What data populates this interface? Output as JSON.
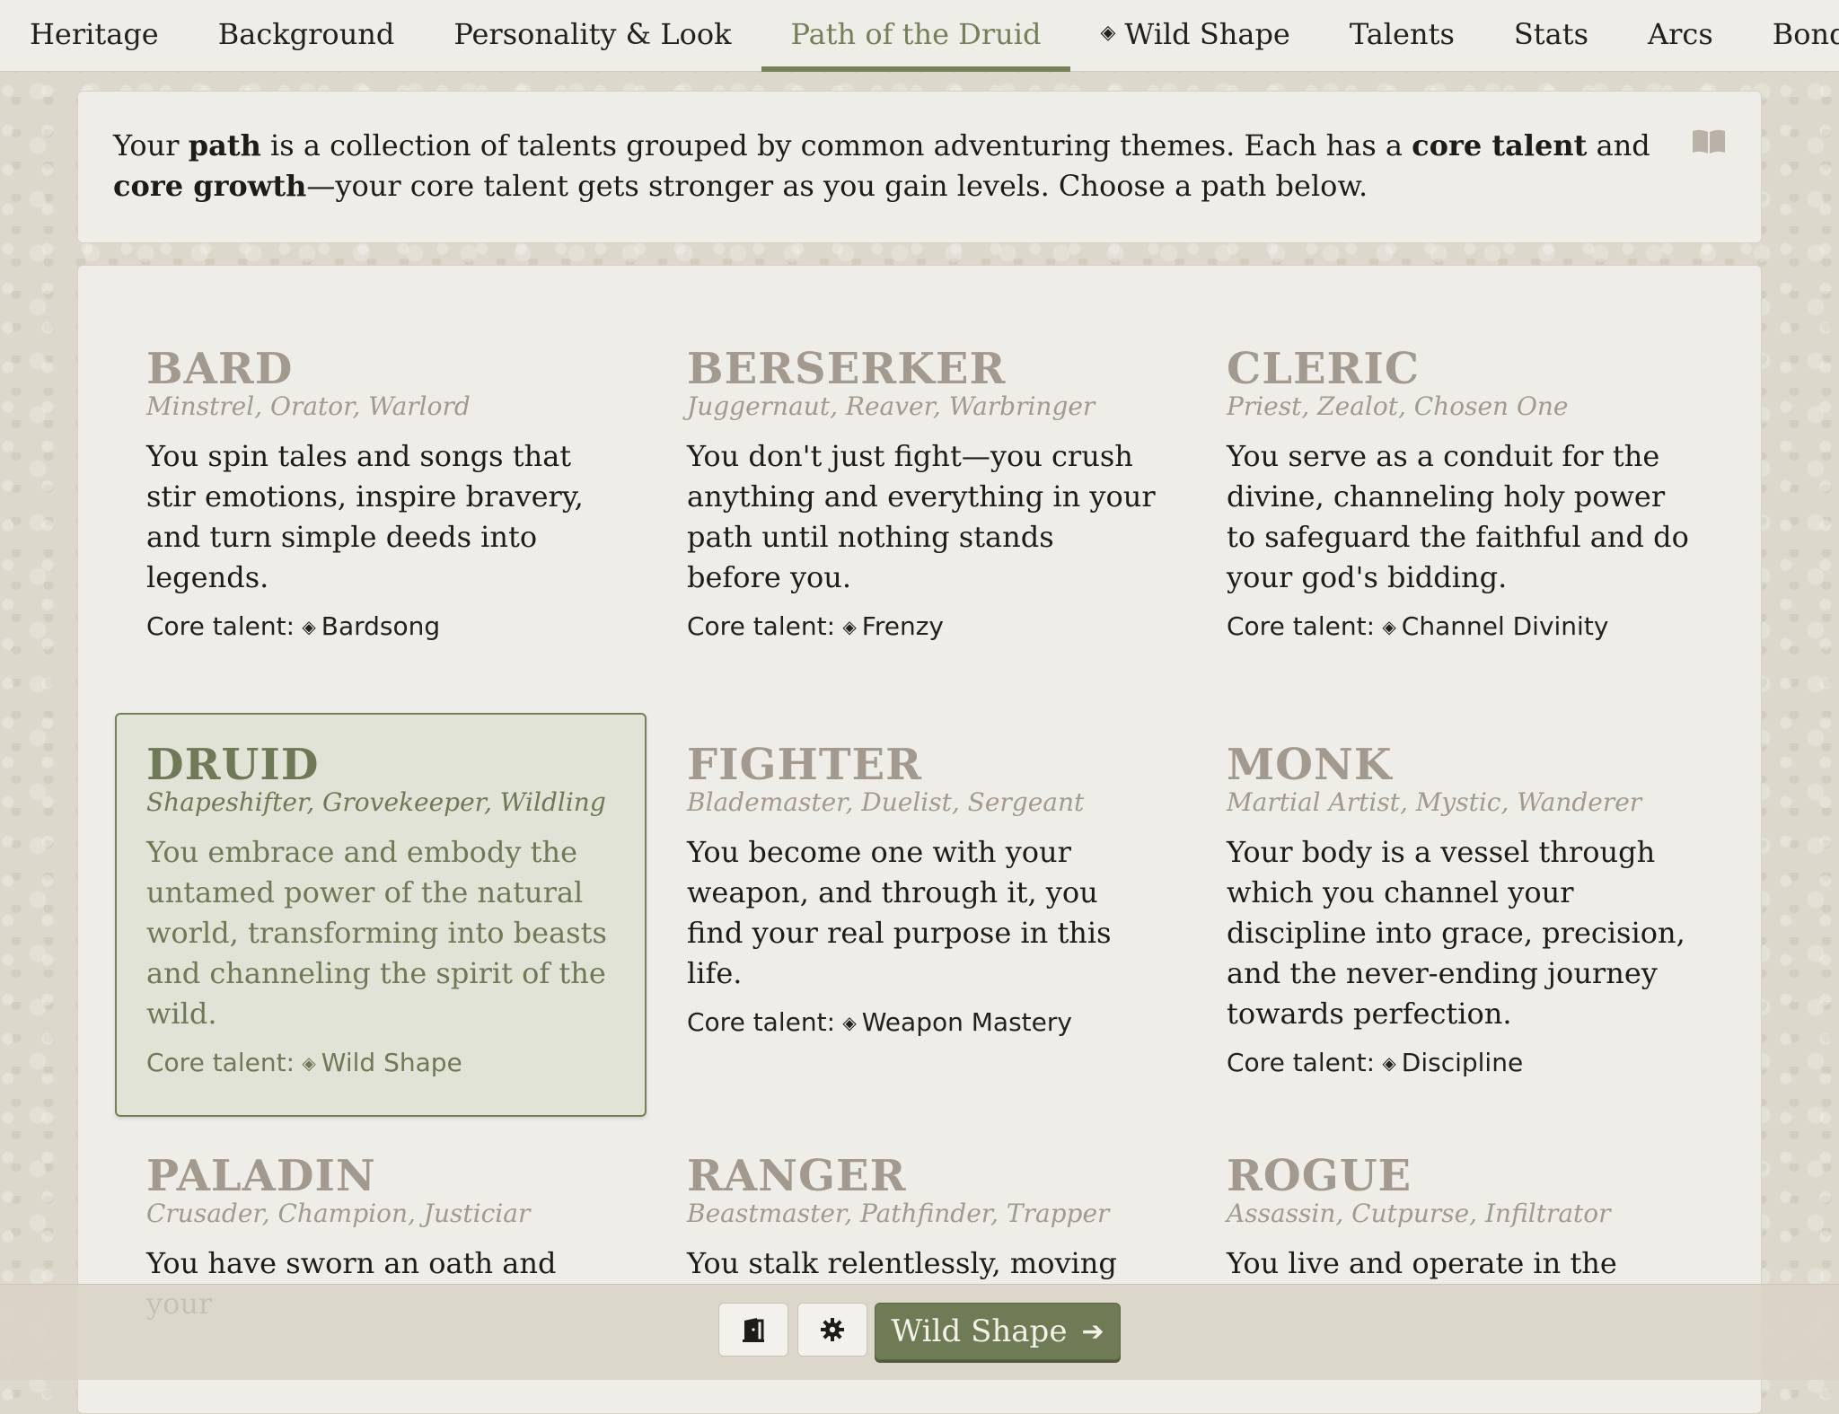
{
  "tabs": [
    {
      "label": "Heritage",
      "diamond": false
    },
    {
      "label": "Background",
      "diamond": false
    },
    {
      "label": "Personality & Look",
      "diamond": false
    },
    {
      "label": "Path of the Druid",
      "diamond": false,
      "active": true
    },
    {
      "label": "Wild Shape",
      "diamond": true
    },
    {
      "label": "Talents",
      "diamond": false
    },
    {
      "label": "Stats",
      "diamond": false
    },
    {
      "label": "Arcs",
      "diamond": false
    },
    {
      "label": "Bonds",
      "diamond": false
    }
  ],
  "intro": {
    "t1": "Your ",
    "b1": "path",
    "t2": " is a collection of talents grouped by common adventuring themes. Each has a ",
    "b2": "core talent",
    "t3": " and ",
    "b3": "core growth",
    "t4": "—your core talent gets stronger as you gain levels. Choose a path below.",
    "icon": "book-icon"
  },
  "core_prefix": "Core talent:",
  "paths": [
    {
      "name": "BARD",
      "sub": "Minstrel, Orator, Warlord",
      "desc": "You spin tales and songs that stir emotions, inspire bravery, and turn simple deeds into legends.",
      "core": "Bardsong"
    },
    {
      "name": "BERSERKER",
      "sub": "Juggernaut, Reaver, Warbringer",
      "desc": "You don't just fight—you crush anything and everything in your path until nothing stands before you.",
      "core": "Frenzy"
    },
    {
      "name": "CLERIC",
      "sub": "Priest, Zealot, Chosen One",
      "desc": "You serve as a conduit for the divine, channeling holy power to safeguard the faithful and do your god's bidding.",
      "core": "Channel Divinity"
    },
    {
      "name": "DRUID",
      "sub": "Shapeshifter, Grovekeeper, Wildling",
      "desc": "You embrace and embody the untamed power of the natural world, transforming into beasts and channeling the spirit of the wild.",
      "core": "Wild Shape",
      "selected": true
    },
    {
      "name": "FIGHTER",
      "sub": "Blademaster, Duelist, Sergeant",
      "desc": "You become one with your weapon, and through it, you find your real purpose in this life.",
      "core": "Weapon Mastery"
    },
    {
      "name": "MONK",
      "sub": "Martial Artist, Mystic, Wanderer",
      "desc": "Your body is a vessel through which you channel your discipline into grace, precision, and the never-ending journey towards perfection.",
      "core": "Discipline"
    },
    {
      "name": "PALADIN",
      "sub": "Crusader, Champion, Justiciar",
      "desc": "You have sworn an oath and your",
      "core": ""
    },
    {
      "name": "RANGER",
      "sub": "Beastmaster, Pathfinder, Trapper",
      "desc": "You stalk relentlessly, moving",
      "core": ""
    },
    {
      "name": "ROGUE",
      "sub": "Assassin, Cutpurse, Infiltrator",
      "desc": "You live and operate in the",
      "core": ""
    }
  ],
  "bottom": {
    "exit_icon": "door-exit-icon",
    "settings_icon": "gear-icon",
    "next_label": "Wild Shape",
    "next_icon": "arrow-right-icon"
  },
  "colors": {
    "accent": "#75805a",
    "muted_title": "#a39a8f",
    "panel": "#efede7"
  }
}
